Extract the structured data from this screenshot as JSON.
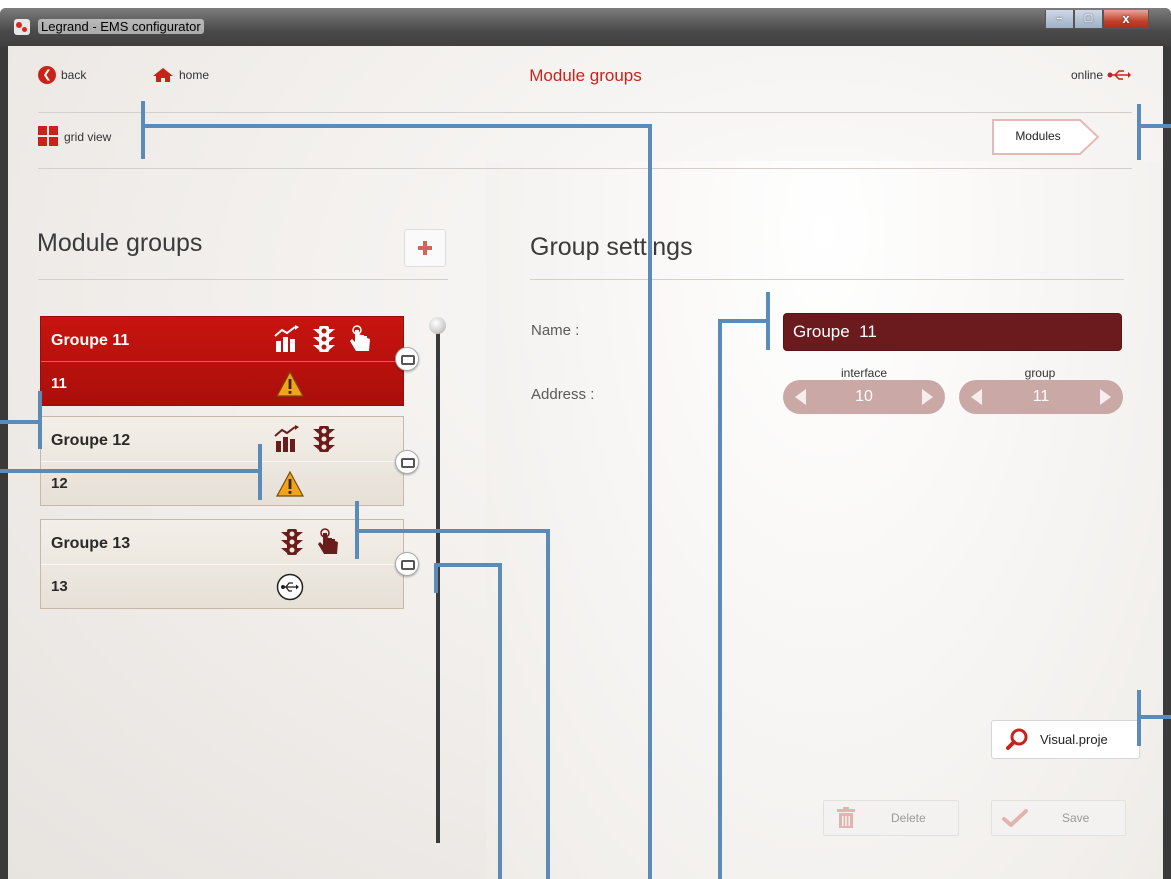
{
  "window": {
    "title": "Legrand - EMS configurator",
    "minimize": "–",
    "maximize": "▢",
    "close": "x"
  },
  "nav": {
    "back_label": "back",
    "home_label": "home",
    "page_title": "Module groups",
    "status_label": "online",
    "grid_view_label": "grid view",
    "modules_label": "Modules"
  },
  "left_panel": {
    "heading": "Module groups",
    "groups": [
      {
        "name": "Groupe  11",
        "address": "11",
        "selected": true,
        "icons": [
          "chart-icon",
          "traffic-light-icon",
          "hand-pointer-icon"
        ],
        "status": "warning-icon"
      },
      {
        "name": "Groupe  12",
        "address": "12",
        "selected": false,
        "icons": [
          "chart-icon",
          "traffic-light-icon"
        ],
        "status": "warning-icon"
      },
      {
        "name": "Groupe  13",
        "address": "13",
        "selected": false,
        "icons": [
          "traffic-light-icon",
          "hand-pointer-icon"
        ],
        "status": "usb-icon"
      }
    ]
  },
  "right_panel": {
    "heading": "Group settings",
    "name_label": "Name :",
    "name_value": "Groupe  11",
    "address_label": "Address :",
    "interface_caption": "interface",
    "interface_value": "10",
    "group_caption": "group",
    "group_value": "11",
    "visual_label": "Visual.proje",
    "delete_label": "Delete",
    "save_label": "Save"
  },
  "colors": {
    "accent": "#c8231b",
    "selected_card": "#b8120e",
    "name_field": "#6b1b1e",
    "stepper": "#caa8a6",
    "annotation_lines": "#5d8bb7"
  }
}
